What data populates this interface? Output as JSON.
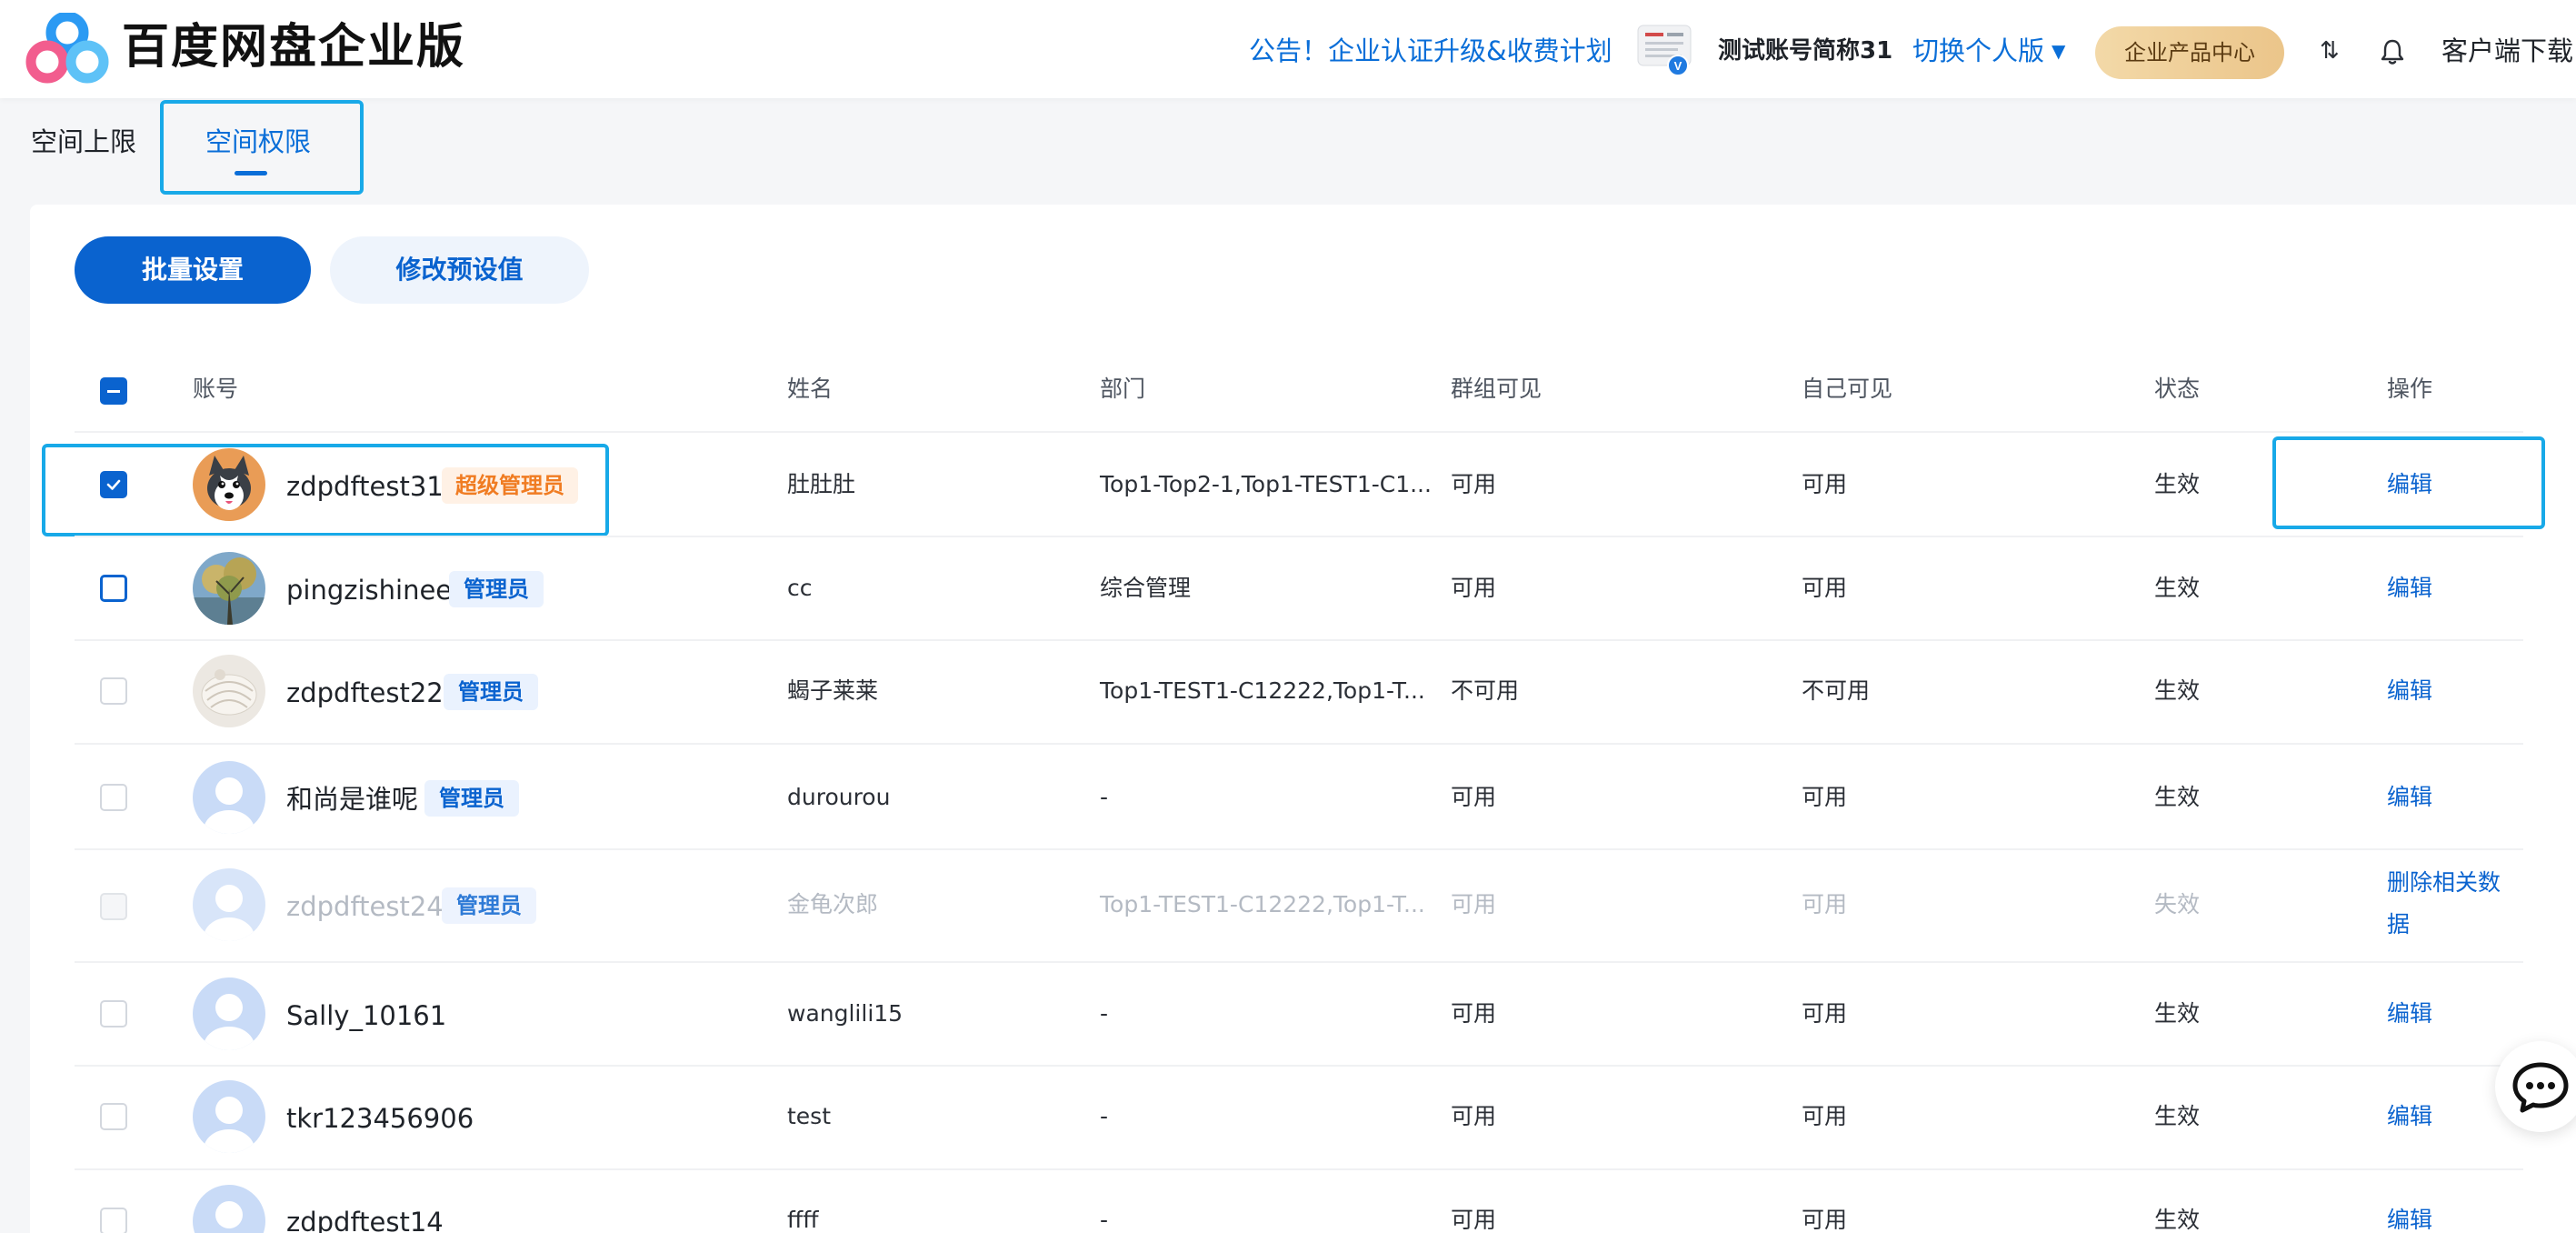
{
  "header": {
    "brand": "百度网盘企业版",
    "notice": "公告！企业认证升级&收费计划",
    "account_name": "测试账号简称31",
    "switch_label": "切换个人版",
    "product_center": "企业产品中心",
    "transfer_glyph": "⇅",
    "download": "客户端下载"
  },
  "tabs": [
    {
      "label": "空间上限",
      "active": false
    },
    {
      "label": "空间权限",
      "active": true
    }
  ],
  "toolbar": {
    "batch_label": "批量设置",
    "preset_label": "修改预设值"
  },
  "table": {
    "columns": [
      "账号",
      "姓名",
      "部门",
      "群组可见",
      "自己可见",
      "状态",
      "操作"
    ],
    "rows": [
      {
        "account": "zdpdftest31",
        "role": "超级管理员",
        "name": "肚肚肚",
        "dept": "Top1-Top2-1,Top1-TEST1-C1...",
        "group_visible": "可用",
        "self_visible": "可用",
        "status": "生效",
        "action": "编辑",
        "checked": true,
        "avatar": "husky"
      },
      {
        "account": "pingzishinee",
        "role": "管理员",
        "name": "cc",
        "dept": "综合管理",
        "group_visible": "可用",
        "self_visible": "可用",
        "status": "生效",
        "action": "编辑",
        "checked": false,
        "avatar": "painting"
      },
      {
        "account": "zdpdftest22",
        "role": "管理员",
        "name": "蝎子莱莱",
        "dept": "Top1-TEST1-C12222,Top1-T...",
        "group_visible": "不可用",
        "self_visible": "不可用",
        "status": "生效",
        "action": "编辑",
        "checked": false,
        "avatar": "photo"
      },
      {
        "account": "和尚是谁呢",
        "role": "管理员",
        "name": "durourou",
        "dept": "-",
        "group_visible": "可用",
        "self_visible": "可用",
        "status": "生效",
        "action": "编辑",
        "checked": false,
        "avatar": "default"
      },
      {
        "account": "zdpdftest24",
        "role": "管理员",
        "name": "金龟次郎",
        "dept": "Top1-TEST1-C12222,Top1-T...",
        "group_visible": "可用",
        "self_visible": "可用",
        "status": "失效",
        "action": "删除相关数据",
        "checked": false,
        "avatar": "default",
        "disabled": true
      },
      {
        "account": "Sally_10161",
        "role": "",
        "name": "wanglili15",
        "dept": "-",
        "group_visible": "可用",
        "self_visible": "可用",
        "status": "生效",
        "action": "编辑",
        "checked": false,
        "avatar": "default"
      },
      {
        "account": "tkr123456906",
        "role": "",
        "name": "test",
        "dept": "-",
        "group_visible": "可用",
        "self_visible": "可用",
        "status": "生效",
        "action": "编辑",
        "checked": false,
        "avatar": "default"
      },
      {
        "account": "zdpdftest14",
        "role": "",
        "name": "ffff",
        "dept": "-",
        "group_visible": "可用",
        "self_visible": "可用",
        "status": "生效",
        "action": "编辑",
        "checked": false,
        "avatar": "default"
      }
    ]
  },
  "colors": {
    "primary": "#0a63cf",
    "highlight": "#18a9e8",
    "super_admin": "#f07c22"
  },
  "icons": [
    "logo-icon",
    "bell-icon",
    "transfer-icon",
    "chat-icon",
    "verified-icon",
    "caret-down-icon",
    "check-icon"
  ]
}
